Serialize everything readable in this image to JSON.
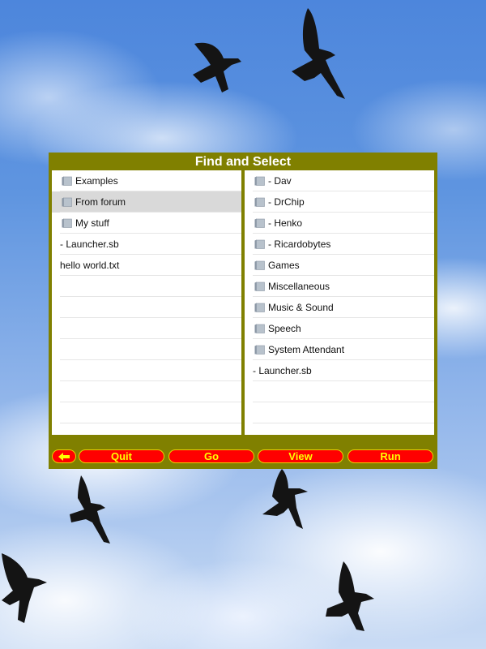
{
  "dialog": {
    "title": "Find and Select"
  },
  "left_list": {
    "items": [
      {
        "label": "Examples",
        "type": "folder",
        "selected": false
      },
      {
        "label": "From forum",
        "type": "folder",
        "selected": true
      },
      {
        "label": "My stuff",
        "type": "folder",
        "selected": false
      },
      {
        "label": "- Launcher.sb",
        "type": "file",
        "selected": false
      },
      {
        "label": "hello world.txt",
        "type": "file",
        "selected": false
      }
    ]
  },
  "right_list": {
    "items": [
      {
        "label": "- Dav",
        "type": "folder"
      },
      {
        "label": "- DrChip",
        "type": "folder"
      },
      {
        "label": "- Henko",
        "type": "folder"
      },
      {
        "label": "- Ricardobytes",
        "type": "folder"
      },
      {
        "label": "Games",
        "type": "folder"
      },
      {
        "label": "Miscellaneous",
        "type": "folder"
      },
      {
        "label": "Music & Sound",
        "type": "folder"
      },
      {
        "label": "Speech",
        "type": "folder"
      },
      {
        "label": "System Attendant",
        "type": "folder"
      },
      {
        "label": "- Launcher.sb",
        "type": "file"
      }
    ]
  },
  "toolbar": {
    "back_icon": "arrow-left-icon",
    "quit_label": "Quit",
    "go_label": "Go",
    "view_label": "View",
    "run_label": "Run"
  },
  "colors": {
    "panel": "#808000",
    "button_bg": "#ff0000",
    "button_text": "#ffff00",
    "selected_row": "#d9d9d9"
  }
}
